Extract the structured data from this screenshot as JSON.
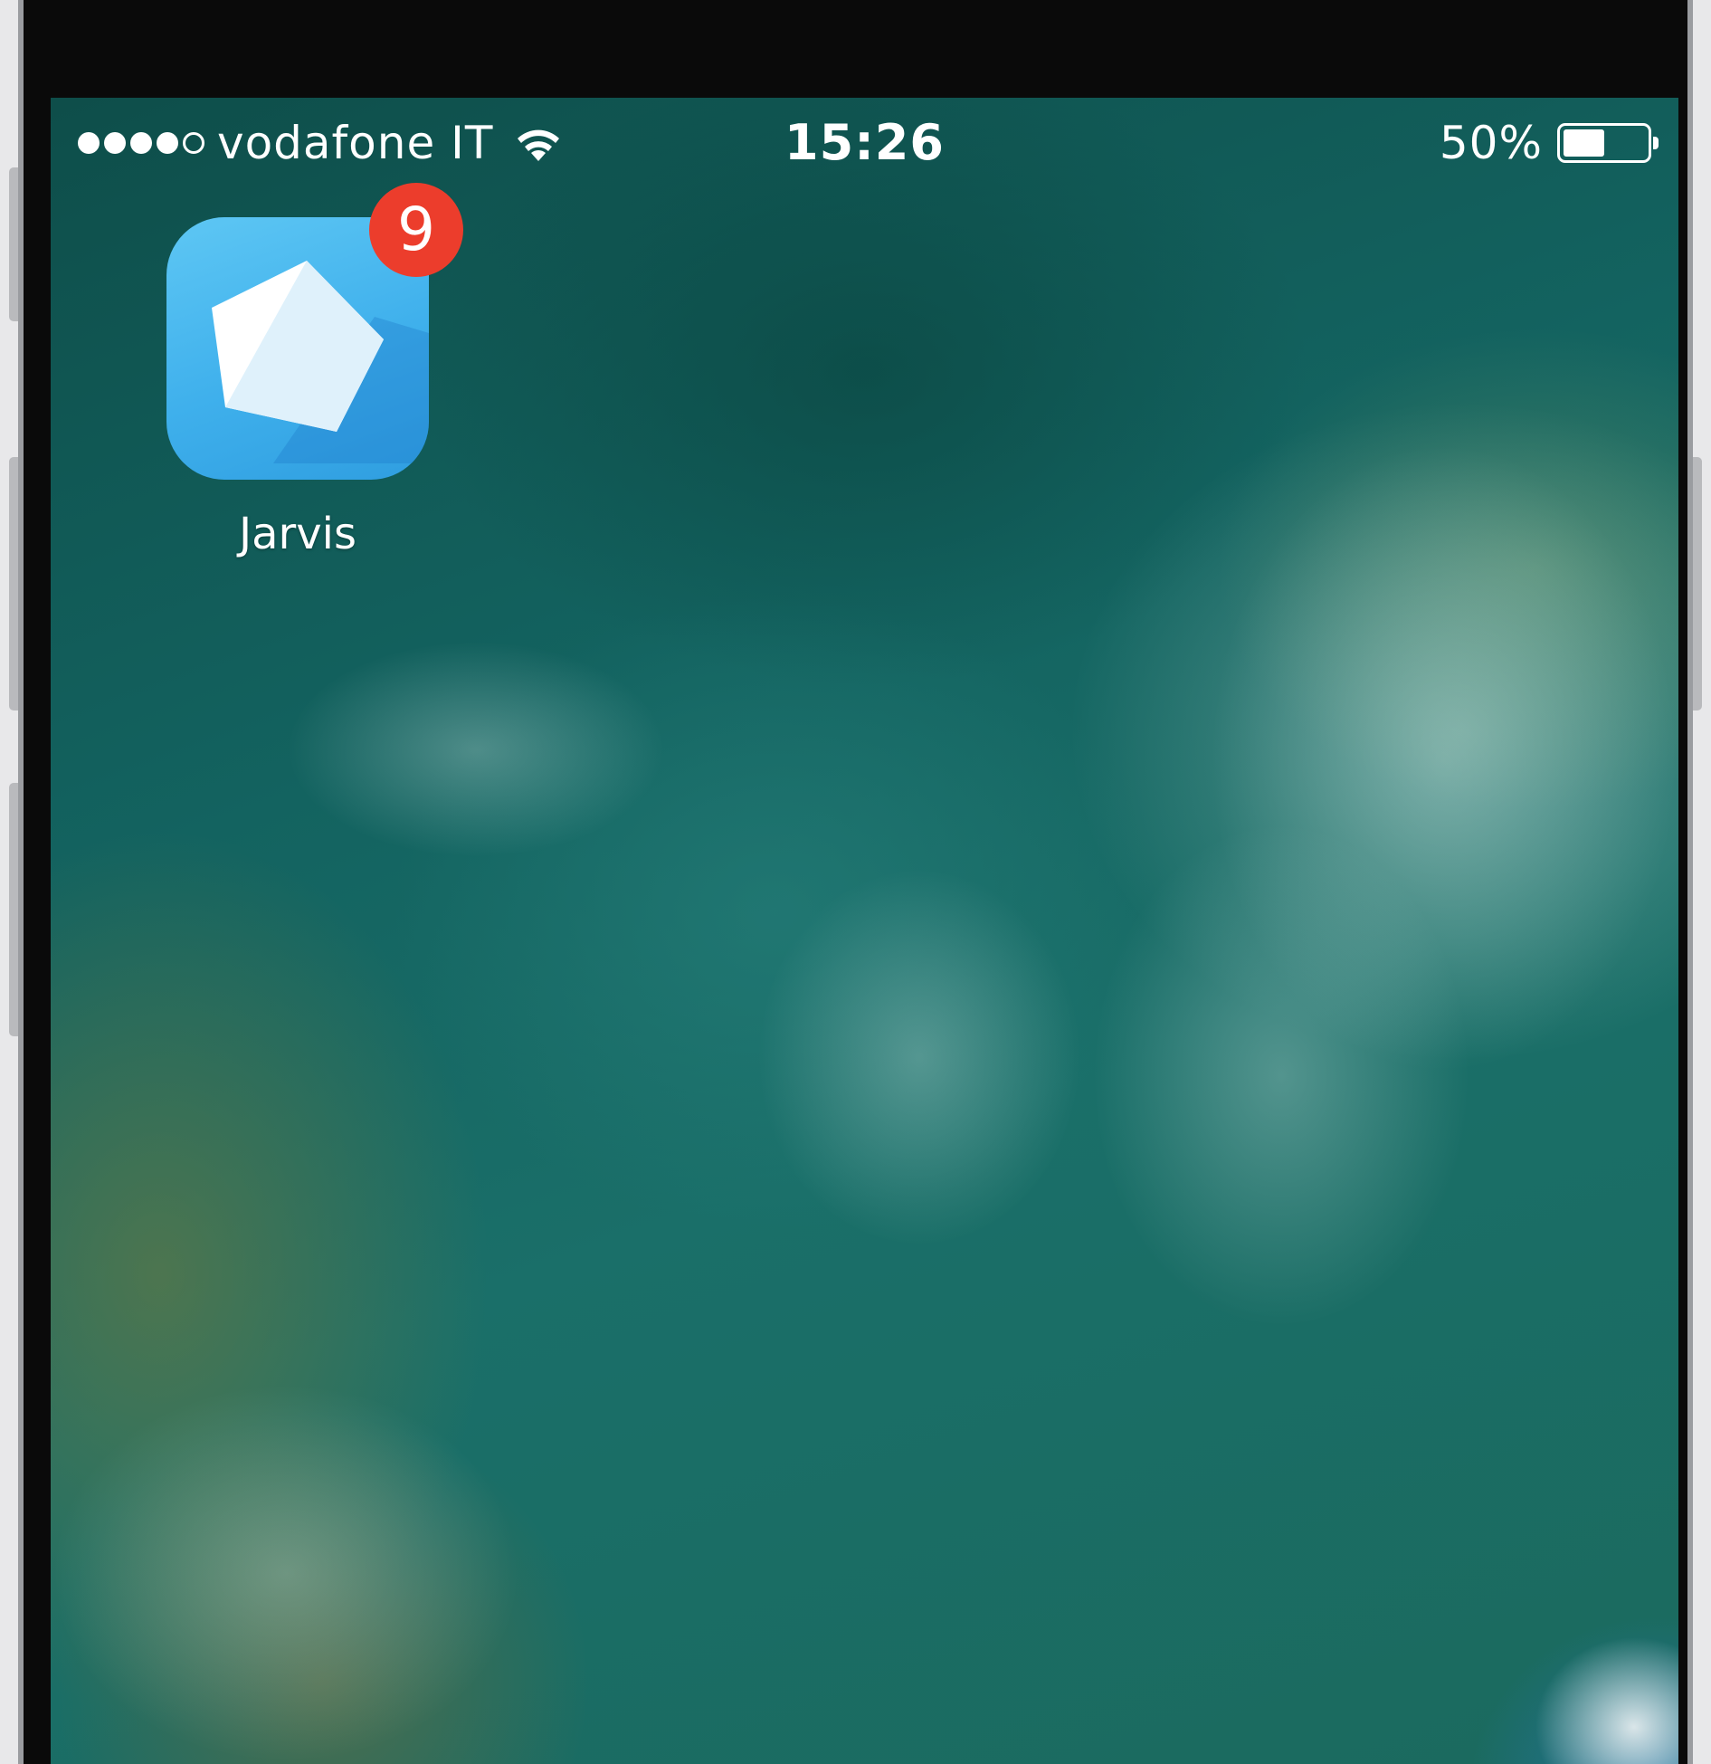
{
  "status_bar": {
    "signal_bars_filled": 4,
    "signal_bars_total": 5,
    "carrier": "vodafone IT",
    "wifi_icon": "wifi-icon",
    "time": "15:26",
    "battery_percent_label": "50%",
    "battery_level": 0.5
  },
  "home_screen": {
    "apps": [
      {
        "label": "Jarvis",
        "icon": "pentagon-app-icon",
        "badge": "9",
        "icon_color": "#3fb0ec",
        "badge_color": "#ec3d2c"
      }
    ]
  }
}
